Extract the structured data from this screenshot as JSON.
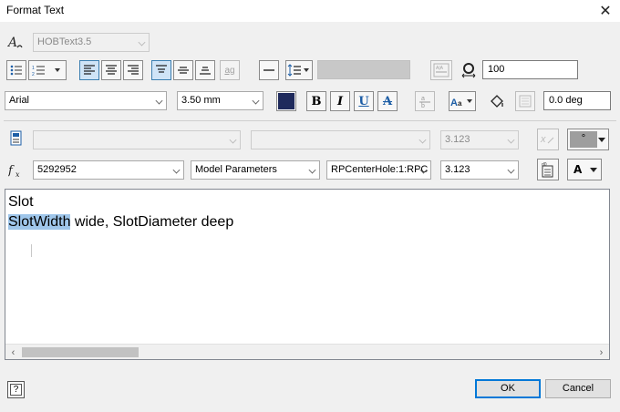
{
  "window": {
    "title": "Format Text",
    "close_symbol": "✕"
  },
  "row1": {
    "style_value": "HOBText3.5"
  },
  "row2": {
    "rotation_value": "100",
    "inline_glyph": "ag",
    "stack_label": "A/A"
  },
  "row3": {
    "font_value": "Arial",
    "size_value": "3.50 mm",
    "color_swatch": "#1f2a5c",
    "bold_label": "B",
    "italic_label": "I",
    "underline_label": "U",
    "strike_label": "A",
    "angle_value": "0.0 deg"
  },
  "row4": {
    "component_value": "",
    "source_value": "",
    "precision_value": "3.123",
    "symbol_value": "°"
  },
  "row5": {
    "part_value": "5292952",
    "type_value": "Model Parameters",
    "param_value": "RPCenterHole:1:RPC",
    "precision_value": "3.123",
    "font_btn_label": "A"
  },
  "editor": {
    "line1": "Slot",
    "line2_highlight": "SlotWidth",
    "line2_rest": " wide, SlotDiameter  deep"
  },
  "footer": {
    "help_label": "?",
    "ok_label": "OK",
    "cancel_label": "Cancel"
  }
}
